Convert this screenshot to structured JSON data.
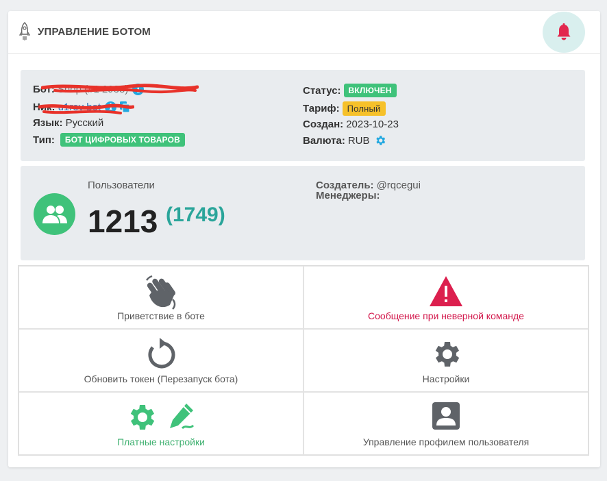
{
  "header": {
    "title": "УПРАВЛЕНИЕ БОТОМ",
    "rocket_icon": "rocket-icon",
    "bell_icon": "bell-icon"
  },
  "info": {
    "bot_label": "Бот:",
    "bot_value": "Shop (#1 2938)",
    "nick_label": "Ник:",
    "nick_value": "u1rev bot",
    "lang_label": "Язык:",
    "lang_value": "Русский",
    "type_label": "Тип:",
    "type_badge": "БОТ ЦИФРОВЫХ ТОВАРОВ",
    "status_label": "Статус:",
    "status_badge": "ВКЛЮЧЕН",
    "tariff_label": "Тариф:",
    "tariff_badge": "Полный",
    "created_label": "Создан:",
    "created_value": "2023-10-23",
    "currency_label": "Валюта:",
    "currency_value": "RUB",
    "info_glyph": "i"
  },
  "users": {
    "label": "Пользователи",
    "count": "1213",
    "total": "(1749)",
    "creator_label": "Создатель:",
    "creator_value": "@rqcegui",
    "managers_label": "Менеджеры:"
  },
  "actions": [
    {
      "label": "Приветствие в боте",
      "icon": "waving-hand-icon"
    },
    {
      "label": "Сообщение при неверной команде",
      "icon": "warning-icon"
    },
    {
      "label": "Обновить токен (Перезапуск бота)",
      "icon": "refresh-icon"
    },
    {
      "label": "Настройки",
      "icon": "gear-icon"
    },
    {
      "label": "Платные настройки",
      "icon": "gear-icon"
    },
    {
      "label": "Управление профилем пользователя",
      "icon": "user-profile-icon"
    }
  ],
  "colors": {
    "accent_green": "#3fc27a",
    "teal": "#2aa59a",
    "danger": "#dc3545",
    "info_blue": "#22a8e0",
    "warning": "#f6c12a"
  }
}
